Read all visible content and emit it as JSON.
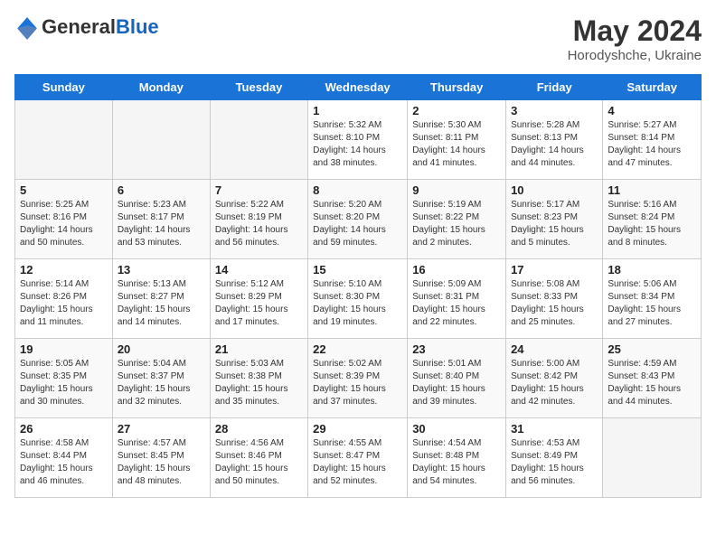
{
  "header": {
    "logo_general": "General",
    "logo_blue": "Blue",
    "month_year": "May 2024",
    "location": "Horodyshche, Ukraine"
  },
  "weekdays": [
    "Sunday",
    "Monday",
    "Tuesday",
    "Wednesday",
    "Thursday",
    "Friday",
    "Saturday"
  ],
  "weeks": [
    [
      {
        "day": "",
        "info": ""
      },
      {
        "day": "",
        "info": ""
      },
      {
        "day": "",
        "info": ""
      },
      {
        "day": "1",
        "info": "Sunrise: 5:32 AM\nSunset: 8:10 PM\nDaylight: 14 hours\nand 38 minutes."
      },
      {
        "day": "2",
        "info": "Sunrise: 5:30 AM\nSunset: 8:11 PM\nDaylight: 14 hours\nand 41 minutes."
      },
      {
        "day": "3",
        "info": "Sunrise: 5:28 AM\nSunset: 8:13 PM\nDaylight: 14 hours\nand 44 minutes."
      },
      {
        "day": "4",
        "info": "Sunrise: 5:27 AM\nSunset: 8:14 PM\nDaylight: 14 hours\nand 47 minutes."
      }
    ],
    [
      {
        "day": "5",
        "info": "Sunrise: 5:25 AM\nSunset: 8:16 PM\nDaylight: 14 hours\nand 50 minutes."
      },
      {
        "day": "6",
        "info": "Sunrise: 5:23 AM\nSunset: 8:17 PM\nDaylight: 14 hours\nand 53 minutes."
      },
      {
        "day": "7",
        "info": "Sunrise: 5:22 AM\nSunset: 8:19 PM\nDaylight: 14 hours\nand 56 minutes."
      },
      {
        "day": "8",
        "info": "Sunrise: 5:20 AM\nSunset: 8:20 PM\nDaylight: 14 hours\nand 59 minutes."
      },
      {
        "day": "9",
        "info": "Sunrise: 5:19 AM\nSunset: 8:22 PM\nDaylight: 15 hours\nand 2 minutes."
      },
      {
        "day": "10",
        "info": "Sunrise: 5:17 AM\nSunset: 8:23 PM\nDaylight: 15 hours\nand 5 minutes."
      },
      {
        "day": "11",
        "info": "Sunrise: 5:16 AM\nSunset: 8:24 PM\nDaylight: 15 hours\nand 8 minutes."
      }
    ],
    [
      {
        "day": "12",
        "info": "Sunrise: 5:14 AM\nSunset: 8:26 PM\nDaylight: 15 hours\nand 11 minutes."
      },
      {
        "day": "13",
        "info": "Sunrise: 5:13 AM\nSunset: 8:27 PM\nDaylight: 15 hours\nand 14 minutes."
      },
      {
        "day": "14",
        "info": "Sunrise: 5:12 AM\nSunset: 8:29 PM\nDaylight: 15 hours\nand 17 minutes."
      },
      {
        "day": "15",
        "info": "Sunrise: 5:10 AM\nSunset: 8:30 PM\nDaylight: 15 hours\nand 19 minutes."
      },
      {
        "day": "16",
        "info": "Sunrise: 5:09 AM\nSunset: 8:31 PM\nDaylight: 15 hours\nand 22 minutes."
      },
      {
        "day": "17",
        "info": "Sunrise: 5:08 AM\nSunset: 8:33 PM\nDaylight: 15 hours\nand 25 minutes."
      },
      {
        "day": "18",
        "info": "Sunrise: 5:06 AM\nSunset: 8:34 PM\nDaylight: 15 hours\nand 27 minutes."
      }
    ],
    [
      {
        "day": "19",
        "info": "Sunrise: 5:05 AM\nSunset: 8:35 PM\nDaylight: 15 hours\nand 30 minutes."
      },
      {
        "day": "20",
        "info": "Sunrise: 5:04 AM\nSunset: 8:37 PM\nDaylight: 15 hours\nand 32 minutes."
      },
      {
        "day": "21",
        "info": "Sunrise: 5:03 AM\nSunset: 8:38 PM\nDaylight: 15 hours\nand 35 minutes."
      },
      {
        "day": "22",
        "info": "Sunrise: 5:02 AM\nSunset: 8:39 PM\nDaylight: 15 hours\nand 37 minutes."
      },
      {
        "day": "23",
        "info": "Sunrise: 5:01 AM\nSunset: 8:40 PM\nDaylight: 15 hours\nand 39 minutes."
      },
      {
        "day": "24",
        "info": "Sunrise: 5:00 AM\nSunset: 8:42 PM\nDaylight: 15 hours\nand 42 minutes."
      },
      {
        "day": "25",
        "info": "Sunrise: 4:59 AM\nSunset: 8:43 PM\nDaylight: 15 hours\nand 44 minutes."
      }
    ],
    [
      {
        "day": "26",
        "info": "Sunrise: 4:58 AM\nSunset: 8:44 PM\nDaylight: 15 hours\nand 46 minutes."
      },
      {
        "day": "27",
        "info": "Sunrise: 4:57 AM\nSunset: 8:45 PM\nDaylight: 15 hours\nand 48 minutes."
      },
      {
        "day": "28",
        "info": "Sunrise: 4:56 AM\nSunset: 8:46 PM\nDaylight: 15 hours\nand 50 minutes."
      },
      {
        "day": "29",
        "info": "Sunrise: 4:55 AM\nSunset: 8:47 PM\nDaylight: 15 hours\nand 52 minutes."
      },
      {
        "day": "30",
        "info": "Sunrise: 4:54 AM\nSunset: 8:48 PM\nDaylight: 15 hours\nand 54 minutes."
      },
      {
        "day": "31",
        "info": "Sunrise: 4:53 AM\nSunset: 8:49 PM\nDaylight: 15 hours\nand 56 minutes."
      },
      {
        "day": "",
        "info": ""
      }
    ]
  ]
}
